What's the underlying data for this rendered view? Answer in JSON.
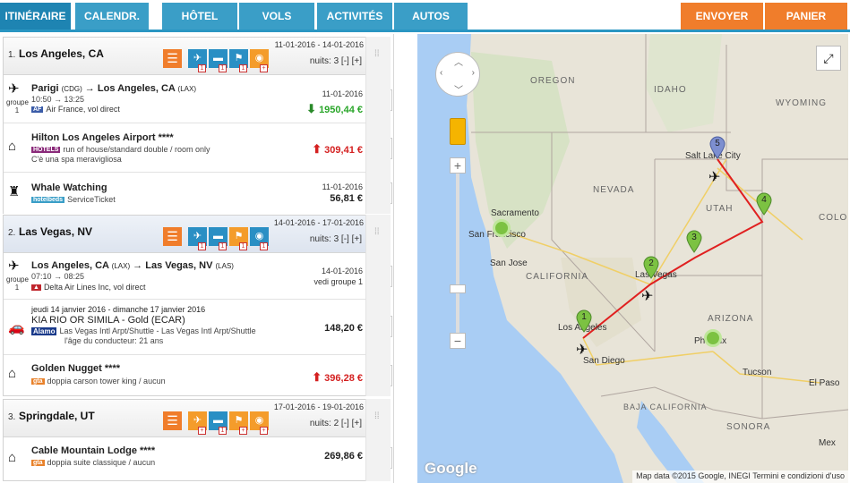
{
  "nav": {
    "tabs": [
      "ITINÉRAIRE",
      "CALENDR.",
      "HÔTEL",
      "VOLS",
      "ACTIVITÉS",
      "AUTOS"
    ],
    "send_label": "ENVOYER",
    "cart_label": "PANIER"
  },
  "destinations": [
    {
      "num": "1.",
      "name": "Los Angeles, CA",
      "dates": "11-01-2016 - 14-01-2016",
      "nights_label": "nuits:",
      "nights": "3",
      "minus": "[-]",
      "plus": "[+]",
      "icon_badges": [
        "1",
        "1",
        "1",
        "+"
      ],
      "items": [
        {
          "kind": "flight",
          "title_from": "Parigi",
          "code_from": "(CDG)",
          "title_to": "Los Angeles, CA",
          "code_to": "(LAX)",
          "time": "10:50 → 13:25",
          "carrier": "Air France, vol direct",
          "group": "groupe",
          "group_num": "1",
          "date": "11-01-2016",
          "price": "1950,44 €",
          "trend": "down"
        },
        {
          "kind": "hotel",
          "title": "Hilton Los Angeles Airport ****",
          "logo": "HOTELS",
          "line1": "run of house/standard double / room only",
          "line2": "C'è una spa meravigliosa",
          "price": "309,41 €",
          "trend": "up"
        },
        {
          "kind": "activity",
          "title": "Whale Watching",
          "logo": "hotelbeds",
          "line1": "ServiceTicket",
          "date": "11-01-2016",
          "price": "56,81 €"
        }
      ]
    },
    {
      "num": "2.",
      "name": "Las Vegas, NV",
      "dates": "14-01-2016 - 17-01-2016",
      "nights_label": "nuits:",
      "nights": "3",
      "minus": "[-]",
      "plus": "[+]",
      "icon_badges": [
        "1",
        "1",
        "1",
        "1"
      ],
      "items": [
        {
          "kind": "flight",
          "title_from": "Los Angeles, CA",
          "code_from": "(LAX)",
          "title_to": "Las Vegas, NV",
          "code_to": "(LAS)",
          "time": "07:10 → 08:25",
          "carrier": "Delta Air Lines Inc, vol direct",
          "group": "groupe",
          "group_num": "1",
          "date": "14-01-2016",
          "note": "vedi groupe 1"
        },
        {
          "kind": "car",
          "dates_line": "jeudi 14 janvier 2016 - dimanche 17 janvier 2016",
          "title": "KIA RIO OR SIMILA - Gold (ECAR)",
          "logo": "Alamo",
          "line1": "Las Vegas Intl Arpt/Shuttle - Las Vegas Intl Arpt/Shuttle",
          "line2": "l'âge du conducteur: 21 ans",
          "price": "148,20 €"
        },
        {
          "kind": "hotel",
          "title": "Golden Nugget ****",
          "logo": "gta",
          "line1": "doppia carson tower king / aucun",
          "price": "396,28 €",
          "trend": "up"
        }
      ]
    },
    {
      "num": "3.",
      "name": "Springdale, UT",
      "dates": "17-01-2016 - 19-01-2016",
      "nights_label": "nuits:",
      "nights": "2",
      "minus": "[-]",
      "plus": "[+]",
      "icon_badges": [
        "+",
        "1",
        "+",
        "+"
      ],
      "items": [
        {
          "kind": "hotel",
          "title": "Cable Mountain Lodge ****",
          "logo": "gta",
          "line1": "doppia suite classique / aucun",
          "price": "269,86 €"
        }
      ]
    }
  ],
  "map": {
    "states": [
      "OREGON",
      "IDAHO",
      "WYOMING",
      "NEVADA",
      "UTAH",
      "CALIFORNIA",
      "ARIZONA",
      "BAJA CALIFORNIA",
      "SONORA",
      "COLO"
    ],
    "cities": [
      "Salt Lake City",
      "Sacramento",
      "San Francisco",
      "San Jose",
      "Las Vegas",
      "Los Angeles",
      "San Diego",
      "Phoenix",
      "Tucson",
      "El Paso",
      "Mex"
    ],
    "pins": [
      "1",
      "2",
      "3",
      "4",
      "5"
    ],
    "attribution": "Map data ©2015 Google, INEGI   Termini e condizioni d'uso",
    "logo": "Google",
    "zoom_in": "+",
    "zoom_out": "−",
    "colors": {
      "route": "#e02020",
      "pin_green": "#7cc242",
      "pin_blue": "#7d8fd0",
      "water": "#a9cdf4",
      "land": "#e8e4d8"
    }
  }
}
